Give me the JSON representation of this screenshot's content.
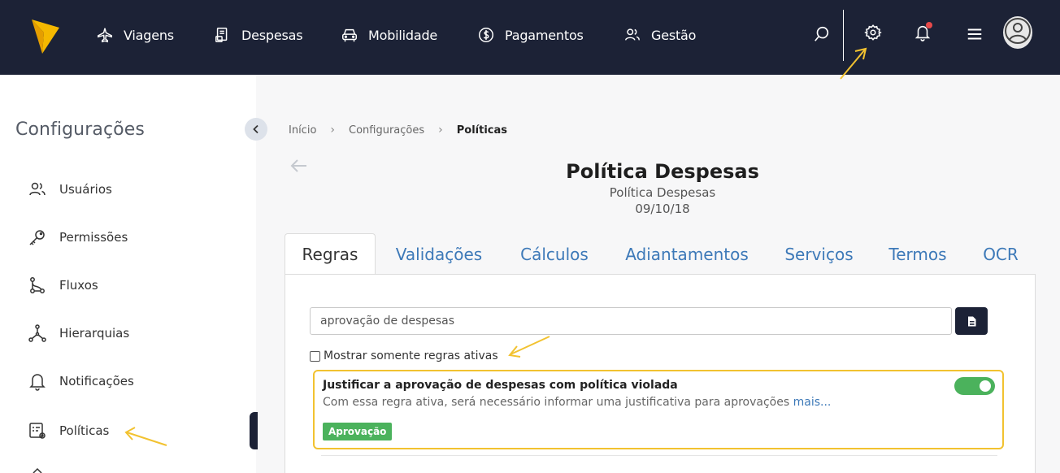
{
  "topbar": {
    "nav": [
      {
        "label": "Viagens",
        "icon": "airplane-icon"
      },
      {
        "label": "Despesas",
        "icon": "receipt-icon"
      },
      {
        "label": "Mobilidade",
        "icon": "car-icon"
      },
      {
        "label": "Pagamentos",
        "icon": "dollar-circle-icon"
      },
      {
        "label": "Gestão",
        "icon": "users-icon"
      }
    ],
    "icons": [
      "search-icon",
      "gear-icon",
      "bell-icon",
      "hamburger-menu-icon",
      "user-avatar-icon"
    ]
  },
  "sidebar": {
    "title": "Configurações",
    "items": [
      {
        "label": "Usuários",
        "icon": "users-icon"
      },
      {
        "label": "Permissões",
        "icon": "key-icon"
      },
      {
        "label": "Fluxos",
        "icon": "flow-icon"
      },
      {
        "label": "Hierarquias",
        "icon": "hierarchy-icon"
      },
      {
        "label": "Notificações",
        "icon": "bell-icon"
      },
      {
        "label": "Políticas",
        "icon": "policy-icon"
      }
    ],
    "active_item": "Políticas"
  },
  "breadcrumb": [
    "Início",
    "Configurações",
    "Políticas"
  ],
  "page": {
    "title": "Política Despesas",
    "subtitle": "Política Despesas",
    "date": "09/10/18"
  },
  "tabs": [
    "Regras",
    "Validações",
    "Cálculos",
    "Adiantamentos",
    "Serviços",
    "Termos",
    "OCR"
  ],
  "active_tab": "Regras",
  "search": {
    "value": "aprovação de despesas"
  },
  "filter": {
    "label": "Mostrar somente regras ativas",
    "checked": false
  },
  "rule": {
    "title": "Justificar a aprovação de despesas com política violada",
    "description": "Com essa regra ativa, será necessário informar uma justificativa para aprovações",
    "more_link": "mais...",
    "tag": "Aprovação",
    "enabled": true
  },
  "colors": {
    "nav_bg": "#1c2236",
    "accent_yellow": "#f2c230",
    "toggle_green": "#4bb25c",
    "link_blue": "#3d79b8"
  }
}
